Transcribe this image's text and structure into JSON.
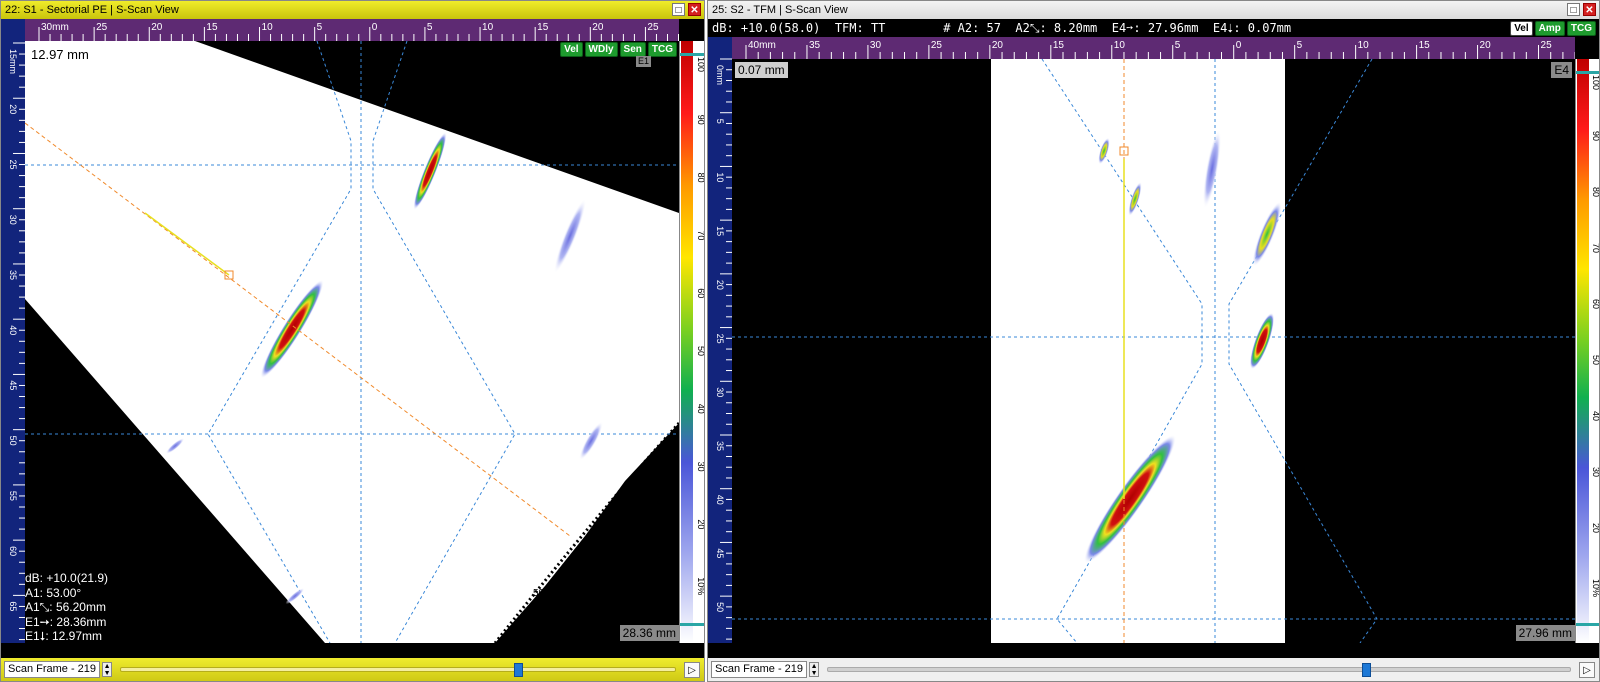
{
  "window1": {
    "title": "22: S1 - Sectorial PE | S-Scan View",
    "hruler_labels": [
      "30mm",
      "25",
      "20",
      "15",
      "10",
      "5",
      "0",
      "5",
      "10",
      "15",
      "20",
      "25"
    ],
    "vruler_labels": [
      "15mm",
      "20",
      "25",
      "30",
      "35",
      "40",
      "45",
      "50",
      "55",
      "60",
      "65"
    ],
    "badges": [
      "Vel",
      "WDly",
      "Sen",
      "TCG"
    ],
    "cursor_value": "12.97 mm",
    "corner_tag": "E1",
    "bottom_value": "28.36 mm",
    "angle_labels": [
      "55",
      "50"
    ],
    "stats": [
      "dB: +10.0(21.9)",
      "A1: 53.00°",
      "A1⤡: 56.20mm",
      "E1➙: 28.36mm",
      "E1⭣: 12.97mm"
    ],
    "colorbar_labels": [
      "100",
      "90",
      "80",
      "70",
      "60",
      "50",
      "40",
      "30",
      "20",
      "10%"
    ],
    "scan_frame_label": "Scan Frame - 219",
    "scan_position": 0.71
  },
  "window2": {
    "title": "25: S2 - TFM | S-Scan View",
    "info": "dB: +10.0(58.0)  TFM: TT        # A2: 57  A2⤡: 8.20mm  E4➙: 27.96mm  E4⭣: 0.07mm",
    "hruler_labels": [
      "40mm",
      "35",
      "30",
      "25",
      "20",
      "15",
      "10",
      "5",
      "0",
      "5",
      "10",
      "15",
      "20",
      "25"
    ],
    "vruler_labels": [
      "0mm",
      "5",
      "10",
      "15",
      "20",
      "25",
      "30",
      "35",
      "40",
      "45",
      "50"
    ],
    "badges": [
      "Vel",
      "Amp",
      "TCG"
    ],
    "cursor_value": "0.07 mm",
    "corner_tag": "E4",
    "bottom_value": "27.96 mm",
    "colorbar_labels": [
      "100",
      "90",
      "80",
      "70",
      "60",
      "50",
      "40",
      "30",
      "20",
      "10%"
    ],
    "scan_frame_label": "Scan Frame - 219",
    "scan_position": 0.72
  },
  "colors": {
    "title_active": "#e6e21c",
    "ruler_purple": "#5e2a73",
    "ruler_blue": "#12247c",
    "badge_green": "#1e9b2e",
    "cursor_orange": "#f08a2c",
    "grid_blue": "#3a88d8"
  }
}
